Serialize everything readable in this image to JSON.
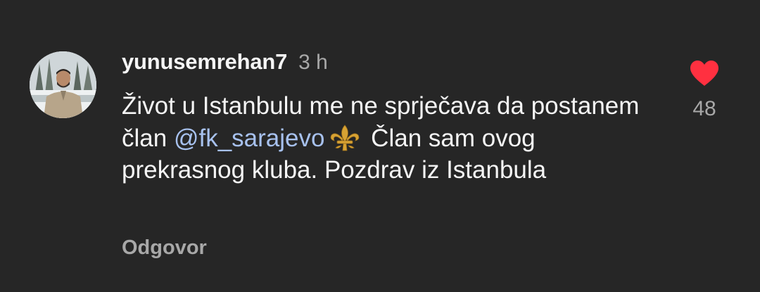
{
  "comment": {
    "username": "yunusemrehan7",
    "timestamp": "3 h",
    "text_before_mention": "Život u Istanbulu me ne sprječava da postanem član ",
    "mention": "@fk_sarajevo",
    "text_after_mention": " Član sam ovog prekrasnog kluba. Pozdrav iz Istanbula",
    "reply_label": "Odgovor",
    "like_count": "48",
    "liked": true,
    "emoji": "fleur-de-lis-icon"
  },
  "colors": {
    "background": "#262626",
    "text": "#f5f5f5",
    "secondary_text": "#a8a8a8",
    "mention": "#a7c1ee",
    "heart": "#ff3040",
    "emoji_gold": "#d7a233"
  }
}
